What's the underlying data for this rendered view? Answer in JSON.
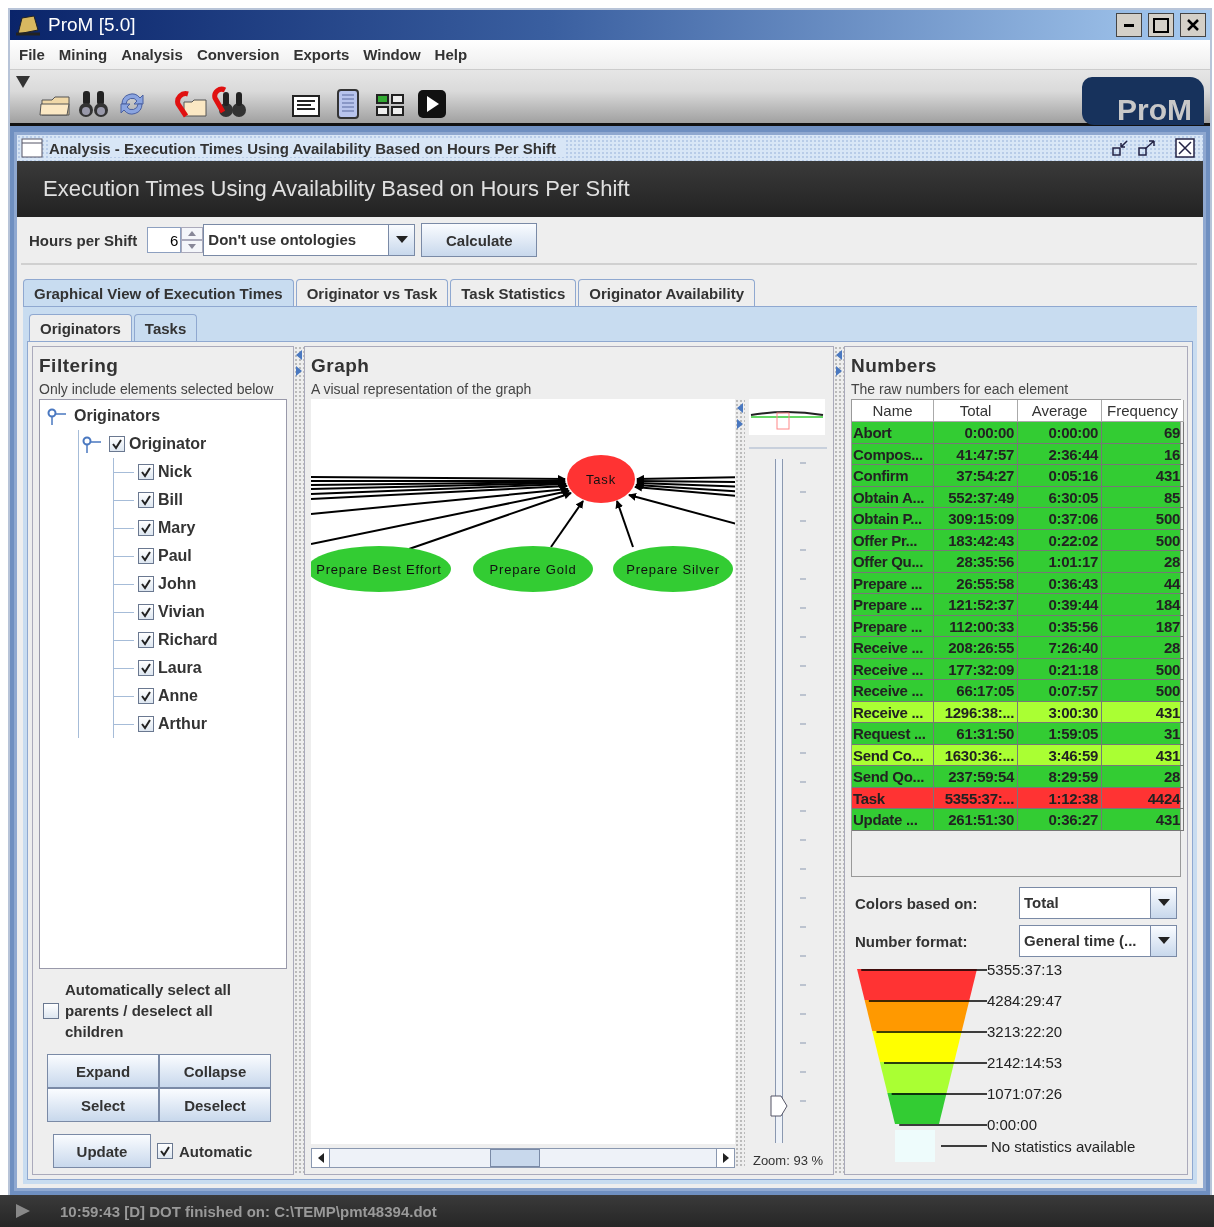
{
  "window": {
    "title": "ProM [5.0]"
  },
  "menu": [
    "File",
    "Mining",
    "Analysis",
    "Conversion",
    "Exports",
    "Window",
    "Help"
  ],
  "toolbar": {
    "logo": "ProM"
  },
  "frame": {
    "title": "Analysis - Execution Times Using Availability Based on Hours Per Shift",
    "header": "Execution Times Using Availability Based on Hours Per Shift"
  },
  "controls": {
    "hours_label": "Hours per Shift",
    "hours_value": "6",
    "ontology": "Don't use ontologies",
    "calculate": "Calculate"
  },
  "tabs": [
    {
      "label": "Graphical View of Execution Times",
      "selected": true
    },
    {
      "label": "Originator vs Task",
      "selected": false
    },
    {
      "label": "Task Statistics",
      "selected": false
    },
    {
      "label": "Originator Availability",
      "selected": false
    }
  ],
  "subtabs": [
    {
      "label": "Originators",
      "selected": false
    },
    {
      "label": "Tasks",
      "selected": true
    }
  ],
  "filtering": {
    "title": "Filtering",
    "subtitle": "Only include elements selected below",
    "tree": [
      {
        "label": "Originators",
        "expanded": true,
        "children": [
          {
            "label": "Originator",
            "checked": true,
            "expanded": true,
            "children": [
              {
                "label": "Nick",
                "checked": true
              },
              {
                "label": "Bill",
                "checked": true
              },
              {
                "label": "Mary",
                "checked": true
              },
              {
                "label": "Paul",
                "checked": true
              },
              {
                "label": "John",
                "checked": true
              },
              {
                "label": "Vivian",
                "checked": true
              },
              {
                "label": "Richard",
                "checked": true
              },
              {
                "label": "Laura",
                "checked": true
              },
              {
                "label": "Anne",
                "checked": true
              },
              {
                "label": "Arthur",
                "checked": true
              }
            ]
          }
        ]
      }
    ],
    "auto_select": {
      "label": "Automatically select all parents / deselect all children",
      "checked": false
    },
    "buttons": [
      "Expand",
      "Collapse",
      "Select",
      "Deselect"
    ],
    "update": "Update",
    "automatic": {
      "label": "Automatic",
      "checked": true
    }
  },
  "graph": {
    "title": "Graph",
    "subtitle": "A visual representation of the graph",
    "nodes": [
      {
        "label": "Task",
        "color": "#ff3333"
      },
      {
        "label": "Prepare Best Effort",
        "color": "#33cc33"
      },
      {
        "label": "Prepare Gold",
        "color": "#33cc33"
      },
      {
        "label": "Prepare Silver",
        "color": "#33cc33"
      }
    ],
    "zoom": {
      "label": "Zoom: 93 %",
      "level": 0.04
    }
  },
  "numbers": {
    "title": "Numbers",
    "subtitle": "The raw numbers for each element",
    "columns": [
      "Name",
      "Total",
      "Average",
      "Frequency"
    ],
    "rows": [
      {
        "cells": [
          "Abort",
          "0:00:00",
          "0:00:00",
          "69"
        ],
        "color": "#33cc33"
      },
      {
        "cells": [
          "Compos...",
          "41:47:57",
          "2:36:44",
          "16"
        ],
        "color": "#33cc33"
      },
      {
        "cells": [
          "Confirm",
          "37:54:27",
          "0:05:16",
          "431"
        ],
        "color": "#33cc33"
      },
      {
        "cells": [
          "Obtain A...",
          "552:37:49",
          "6:30:05",
          "85"
        ],
        "color": "#33cc33"
      },
      {
        "cells": [
          "Obtain P...",
          "309:15:09",
          "0:37:06",
          "500"
        ],
        "color": "#33cc33"
      },
      {
        "cells": [
          "Offer Pr...",
          "183:42:43",
          "0:22:02",
          "500"
        ],
        "color": "#33cc33"
      },
      {
        "cells": [
          "Offer Qu...",
          "28:35:56",
          "1:01:17",
          "28"
        ],
        "color": "#33cc33"
      },
      {
        "cells": [
          "Prepare ...",
          "26:55:58",
          "0:36:43",
          "44"
        ],
        "color": "#33cc33"
      },
      {
        "cells": [
          "Prepare ...",
          "121:52:37",
          "0:39:44",
          "184"
        ],
        "color": "#33cc33"
      },
      {
        "cells": [
          "Prepare ...",
          "112:00:33",
          "0:35:56",
          "187"
        ],
        "color": "#33cc33"
      },
      {
        "cells": [
          "Receive ...",
          "208:26:55",
          "7:26:40",
          "28"
        ],
        "color": "#33cc33"
      },
      {
        "cells": [
          "Receive ...",
          "177:32:09",
          "0:21:18",
          "500"
        ],
        "color": "#33cc33"
      },
      {
        "cells": [
          "Receive ...",
          "66:17:05",
          "0:07:57",
          "500"
        ],
        "color": "#33cc33"
      },
      {
        "cells": [
          "Receive ...",
          "1296:38:...",
          "3:00:30",
          "431"
        ],
        "color": "#aaff33"
      },
      {
        "cells": [
          "Request ...",
          "61:31:50",
          "1:59:05",
          "31"
        ],
        "color": "#33cc33"
      },
      {
        "cells": [
          "Send Co...",
          "1630:36:...",
          "3:46:59",
          "431"
        ],
        "color": "#aaff33"
      },
      {
        "cells": [
          "Send Qo...",
          "237:59:54",
          "8:29:59",
          "28"
        ],
        "color": "#33cc33"
      },
      {
        "cells": [
          "Task",
          "5355:37:...",
          "1:12:38",
          "4424"
        ],
        "color": "#ff3333"
      },
      {
        "cells": [
          "Update ...",
          "261:51:30",
          "0:36:27",
          "431"
        ],
        "color": "#33cc33"
      }
    ],
    "colors_label": "Colors based on:",
    "colors_value": "Total",
    "format_label": "Number format:",
    "format_value": "General time (...",
    "legend": {
      "bands": [
        {
          "color": "#ff3333"
        },
        {
          "color": "#ff9900"
        },
        {
          "color": "#ffff00"
        },
        {
          "color": "#aaff33"
        },
        {
          "color": "#33cc33"
        }
      ],
      "labels": [
        "5355:37:13",
        "4284:29:47",
        "3213:22:20",
        "2142:14:53",
        "1071:07:26",
        "0:00:00"
      ],
      "none_label": "No statistics available"
    }
  },
  "status": "10:59:43 [D] DOT finished on: C:\\TEMP\\pmt48394.dot"
}
